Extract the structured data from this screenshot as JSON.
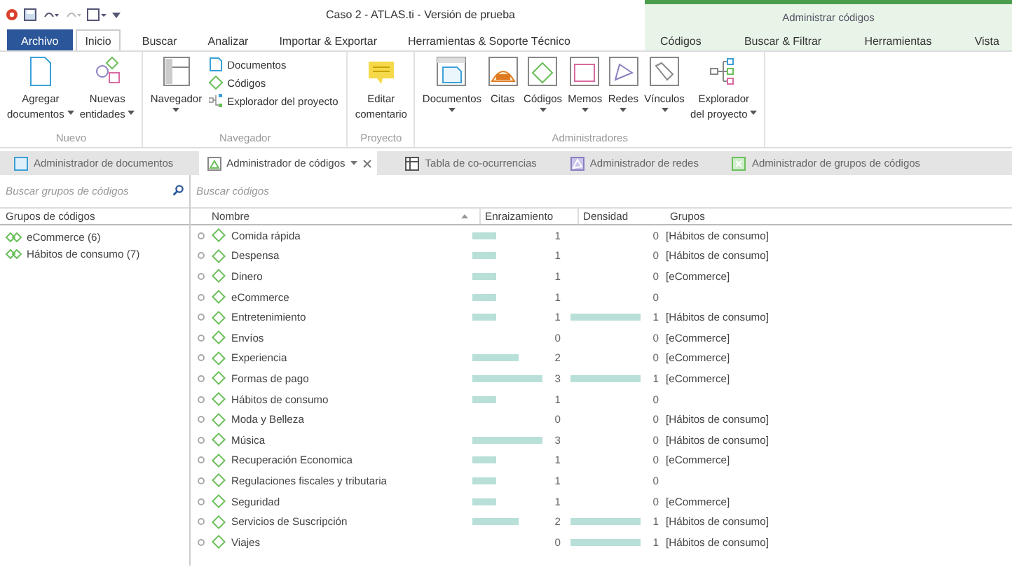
{
  "window": {
    "title": "Caso 2 - ATLAS.ti - Versión de prueba"
  },
  "contextual_tab_group": {
    "label": "Administrar códigos"
  },
  "ribbon_tabs": [
    {
      "label": "Archivo",
      "kind": "file",
      "selected": false
    },
    {
      "label": "Inicio",
      "kind": "normal",
      "selected": true
    },
    {
      "label": "Buscar",
      "kind": "normal",
      "selected": false
    },
    {
      "label": "Analizar",
      "kind": "normal",
      "selected": false
    },
    {
      "label": "Importar & Exportar",
      "kind": "normal",
      "selected": false
    },
    {
      "label": "Herramientas & Soporte Técnico",
      "kind": "normal",
      "selected": false
    },
    {
      "label": "Códigos",
      "kind": "contextual",
      "selected": false
    },
    {
      "label": "Buscar & Filtrar",
      "kind": "contextual",
      "selected": false
    },
    {
      "label": "Herramientas",
      "kind": "contextual",
      "selected": false
    },
    {
      "label": "Vista",
      "kind": "contextual",
      "selected": false
    }
  ],
  "ribbon_groups": [
    {
      "label": "Nuevo",
      "buttons": [
        {
          "kind": "large",
          "lines": [
            "Agregar",
            "documentos"
          ],
          "dropdown": true
        },
        {
          "kind": "large",
          "lines": [
            "Nuevas",
            "entidades"
          ],
          "dropdown": true
        }
      ]
    },
    {
      "label": "Navegador",
      "buttons": [
        {
          "kind": "large",
          "lines": [
            "Navegador"
          ],
          "dropdown": true
        },
        {
          "kind": "small",
          "lines": [
            "Documentos"
          ],
          "dropdown": false
        },
        {
          "kind": "small",
          "lines": [
            "Códigos"
          ],
          "dropdown": false
        },
        {
          "kind": "small",
          "lines": [
            "Explorador del proyecto"
          ],
          "dropdown": false
        }
      ]
    },
    {
      "label": "Proyecto",
      "buttons": [
        {
          "kind": "large",
          "lines": [
            "Editar",
            "comentario"
          ],
          "dropdown": false
        }
      ]
    },
    {
      "label": "Administradores",
      "buttons": [
        {
          "kind": "large",
          "lines": [
            "Documentos"
          ],
          "dropdown": true
        },
        {
          "kind": "large",
          "lines": [
            "Citas"
          ],
          "dropdown": false
        },
        {
          "kind": "large",
          "lines": [
            "Códigos"
          ],
          "dropdown": true
        },
        {
          "kind": "large",
          "lines": [
            "Memos"
          ],
          "dropdown": true
        },
        {
          "kind": "large",
          "lines": [
            "Redes"
          ],
          "dropdown": true
        },
        {
          "kind": "large",
          "lines": [
            "Vínculos"
          ],
          "dropdown": true
        },
        {
          "kind": "large",
          "lines": [
            "Explorador",
            "del proyecto"
          ],
          "dropdown": true
        }
      ]
    }
  ],
  "document_tabs": [
    {
      "label": "Administrador de documentos",
      "selected": false
    },
    {
      "label": "Administrador de códigos",
      "selected": true
    },
    {
      "label": "Tabla de co-ocurrencias",
      "selected": false
    },
    {
      "label": "Administrador de redes",
      "selected": false
    },
    {
      "label": "Administrador de grupos de códigos",
      "selected": false
    }
  ],
  "code_groups_pane": {
    "search": {
      "placeholder": "Buscar grupos de códigos"
    },
    "heading": "Grupos de códigos",
    "items": [
      {
        "label": "eCommerce (6)"
      },
      {
        "label": "Hábitos de consumo (7)"
      }
    ]
  },
  "codes_table": {
    "search": {
      "placeholder": "Buscar códigos"
    },
    "columns": [
      "Nombre",
      "Enraizamiento",
      "Densidad",
      "Grupos"
    ],
    "rows": [
      {
        "name": "Comida rápida",
        "grounding": {
          "value": "1"
        },
        "density": {
          "value": "0"
        },
        "groups": "[Hábitos de consumo]"
      },
      {
        "name": "Despensa",
        "grounding": {
          "value": "1"
        },
        "density": {
          "value": "0"
        },
        "groups": "[Hábitos de consumo]"
      },
      {
        "name": "Dinero",
        "grounding": {
          "value": "1"
        },
        "density": {
          "value": "0"
        },
        "groups": "[eCommerce]"
      },
      {
        "name": "eCommerce",
        "grounding": {
          "value": "1"
        },
        "density": {
          "value": "0"
        }
      },
      {
        "name": "Entretenimiento",
        "grounding": {
          "value": "1"
        },
        "density": {
          "value": "1"
        },
        "groups": "[Hábitos de consumo]"
      },
      {
        "name": "Envíos",
        "grounding": {
          "value": "0"
        },
        "density": {
          "value": "0"
        },
        "groups": "[eCommerce]"
      },
      {
        "name": "Experiencia",
        "grounding": {
          "value": "2"
        },
        "density": {
          "value": "0"
        },
        "groups": "[eCommerce]"
      },
      {
        "name": "Formas de pago",
        "grounding": {
          "value": "3"
        },
        "density": {
          "value": "1"
        },
        "groups": "[eCommerce]"
      },
      {
        "name": "Hábitos de consumo",
        "grounding": {
          "value": "1"
        },
        "density": {
          "value": "0"
        }
      },
      {
        "name": "Moda y Belleza",
        "grounding": {
          "value": "0"
        },
        "density": {
          "value": "0"
        },
        "groups": "[Hábitos de consumo]"
      },
      {
        "name": "Música",
        "grounding": {
          "value": "3"
        },
        "density": {
          "value": "0"
        },
        "groups": "[Hábitos de consumo]"
      },
      {
        "name": "Recuperación Economica",
        "grounding": {
          "value": "1"
        },
        "density": {
          "value": "0"
        },
        "groups": "[eCommerce]"
      },
      {
        "name": "Regulaciones fiscales y tributaria",
        "grounding": {
          "value": "1"
        },
        "density": {
          "value": "0"
        }
      },
      {
        "name": "Seguridad",
        "grounding": {
          "value": "1"
        },
        "density": {
          "value": "0"
        },
        "groups": "[eCommerce]"
      },
      {
        "name": "Servicios de Suscripción",
        "grounding": {
          "value": "2"
        },
        "density": {
          "value": "1"
        },
        "groups": "[Hábitos de consumo]"
      },
      {
        "name": "Viajes",
        "grounding": {
          "value": "0"
        },
        "density": {
          "value": "1"
        },
        "groups": "[Hábitos de consumo]"
      }
    ]
  }
}
